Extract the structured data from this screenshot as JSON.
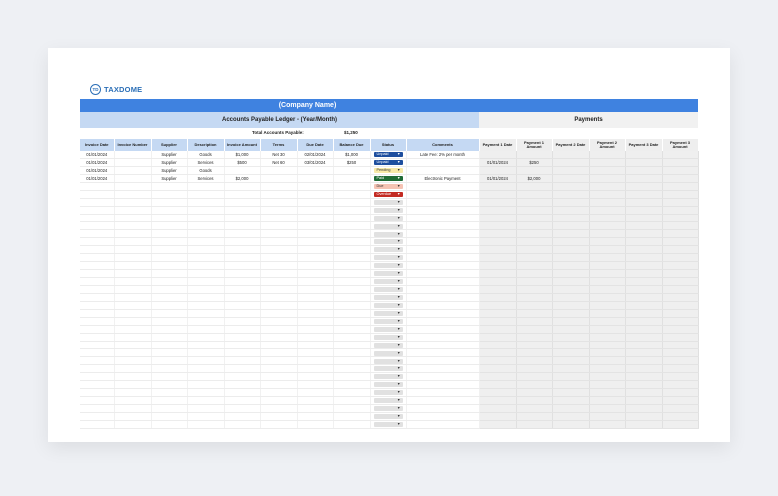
{
  "brand": {
    "mark": "TD",
    "name": "TAXDOME"
  },
  "sheet": {
    "company": "(Company Name)",
    "ledger_title": "Accounts Payable Ledger - (Year/Month)",
    "payments_title": "Payments",
    "total_label": "Total Accounts Payable:",
    "total_value": "$1,250",
    "headers": [
      "Invoice Date",
      "Invoice Number",
      "Supplier",
      "Description",
      "Invoice Amount",
      "Terms",
      "Due Date",
      "Balance Due",
      "Status",
      "Comments",
      "Payment 1 Date",
      "Payment 1 Amount",
      "Payment 2 Date",
      "Payment 2 Amount",
      "Payment 3 Date",
      "Payment 3 Amount"
    ],
    "rows": [
      [
        "01/01/2024",
        "",
        "Supplier",
        "Goods",
        "$1,000",
        "Net 30",
        "02/01/2024",
        "$1,000",
        "Unpaid",
        "Late Fee: 2% per month",
        "",
        "",
        "",
        "",
        "",
        ""
      ],
      [
        "01/01/2024",
        "",
        "Supplier",
        "Services",
        "$500",
        "Net 60",
        "03/01/2024",
        "$250",
        "Unpaid",
        "",
        "01/01/2024",
        "$250",
        "",
        "",
        "",
        ""
      ],
      [
        "01/01/2024",
        "",
        "Supplier",
        "Goods",
        "",
        "",
        "",
        "",
        "Pending",
        "",
        "",
        "",
        "",
        "",
        "",
        ""
      ],
      [
        "01/01/2024",
        "",
        "Supplier",
        "Services",
        "$2,000",
        "",
        "",
        "",
        "Paid",
        "Electronic Payment",
        "01/01/2024",
        "$2,000",
        "",
        "",
        "",
        ""
      ],
      [
        "",
        "",
        "",
        "",
        "",
        "",
        "",
        "",
        "Due",
        "",
        "",
        "",
        "",
        "",
        "",
        ""
      ],
      [
        "",
        "",
        "",
        "",
        "",
        "",
        "",
        "",
        "Overdue",
        "",
        "",
        "",
        "",
        "",
        "",
        ""
      ]
    ],
    "empty_rows": 29
  },
  "colors": {
    "unpaid": "#1d4e9e",
    "pending": "#f7e9a8",
    "paid": "#1f6b35",
    "due": "#f5c3b4",
    "overdue": "#c32a22",
    "header": "#3f82e0",
    "subheader": "#c5d9f3"
  }
}
